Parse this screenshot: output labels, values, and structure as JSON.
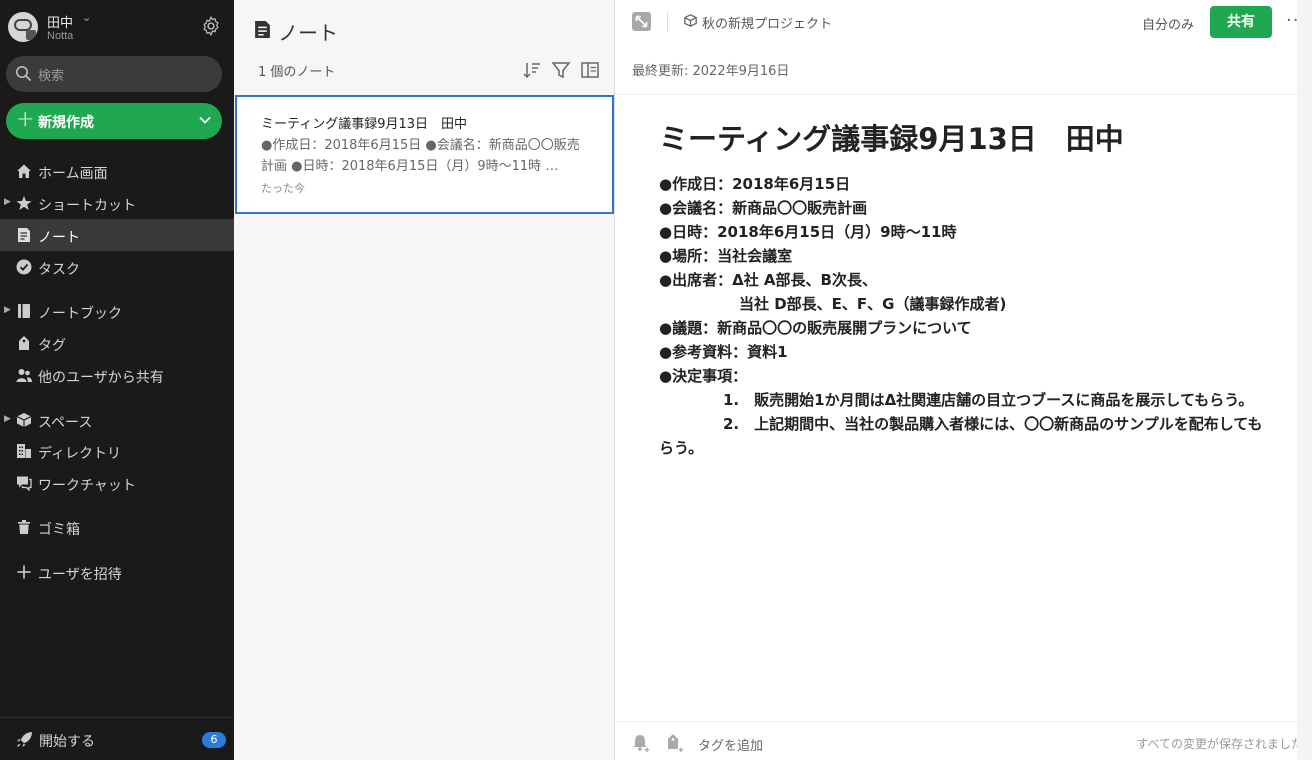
{
  "account": {
    "name": "田中",
    "workspace": "Notta"
  },
  "search": {
    "placeholder": "検索"
  },
  "new_button": {
    "label": "新規作成"
  },
  "nav": [
    {
      "label": "ホーム画面",
      "icon": "home-icon"
    },
    {
      "label": "ショートカット",
      "icon": "star-icon"
    },
    {
      "label": "ノート",
      "icon": "note-icon"
    },
    {
      "label": "タスク",
      "icon": "task-check-icon"
    },
    {
      "label": "ノートブック",
      "icon": "notebook-icon"
    },
    {
      "label": "タグ",
      "icon": "tag-icon"
    },
    {
      "label": "他のユーザから共有",
      "icon": "shared-users-icon"
    },
    {
      "label": "スペース",
      "icon": "space-cube-icon"
    },
    {
      "label": "ディレクトリ",
      "icon": "directory-icon"
    },
    {
      "label": "ワークチャット",
      "icon": "chat-icon"
    },
    {
      "label": "ゴミ箱",
      "icon": "trash-icon"
    },
    {
      "label": "ユーザを招待",
      "icon": "plus-icon"
    }
  ],
  "footer": {
    "label": "開始する",
    "badge": "6"
  },
  "note_list": {
    "title": "ノート",
    "count": "1 個のノート",
    "notes": [
      {
        "title": "ミーティング議事録9月13日　田中",
        "snippet": "●作成日：2018年6月15日 ●会議名：新商品〇〇販売計画 ●日時：2018年6月15日（月）9時〜11時 …",
        "time": "たった今"
      }
    ]
  },
  "editor": {
    "notebook": "秋の新規プロジェクト",
    "visibility": "自分のみ",
    "share_label": "共有",
    "updated": "最終更新: 2022年9月16日",
    "title": "ミーティング議事録9月13日　田中",
    "lines": [
      "●作成日：2018年6月15日",
      "●会議名：新商品〇〇販売計画",
      "●日時：2018年6月15日（月）9時〜11時",
      "●場所：当社会議室",
      "●出席者：Δ社 A部長、B次長、",
      "当社 D部長、E、F、G（議事録作成者)",
      "●議題：新商品〇〇の販売展開プランについて",
      "●参考資料：資料1",
      "●決定事項：",
      "1.　販売開始1か月間はΔ社関連店舗の目立つブースに商品を展示してもらう。",
      "2.　上記期間中、当社の製品購入者様には、〇〇新商品のサンプルを配布してもらう。"
    ],
    "add_tag": "タグを追加",
    "saved": "すべての変更が保存されました"
  },
  "colors": {
    "sidebar_bg": "#1a1a1a",
    "accent_green": "#1fa84f",
    "selection_blue": "#2f76c8",
    "badge_blue": "#2d7bd8"
  }
}
